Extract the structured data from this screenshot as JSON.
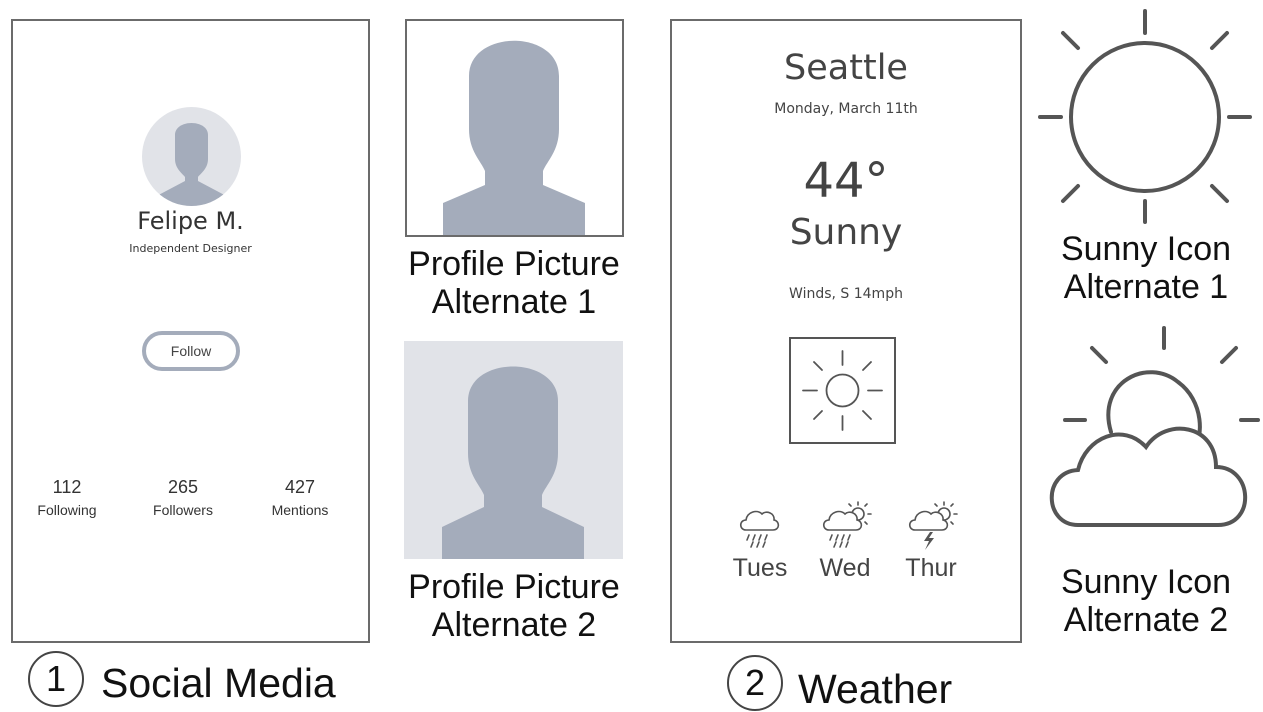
{
  "social": {
    "name": "Felipe M.",
    "role": "Independent Designer",
    "follow_label": "Follow",
    "stats": [
      {
        "value": "112",
        "label": "Following"
      },
      {
        "value": "265",
        "label": "Followers"
      },
      {
        "value": "427",
        "label": "Mentions"
      }
    ],
    "section_number": "1",
    "section_title": "Social Media"
  },
  "profile_alternates": {
    "alt1": [
      "Profile Picture",
      "Alternate 1"
    ],
    "alt2": [
      "Profile Picture",
      "Alternate 2"
    ]
  },
  "weather": {
    "city": "Seattle",
    "date": "Monday, March 11th",
    "temperature": "44°",
    "condition": "Sunny",
    "winds": "Winds, S 14mph",
    "forecast": [
      {
        "day": "Tues",
        "icon": "rain-cloud-icon"
      },
      {
        "day": "Wed",
        "icon": "sun-rain-cloud-icon"
      },
      {
        "day": "Thur",
        "icon": "sun-storm-cloud-icon"
      }
    ],
    "section_number": "2",
    "section_title": "Weather"
  },
  "sunny_alternates": {
    "alt1": [
      "Sunny Icon",
      "Alternate 1"
    ],
    "alt2": [
      "Sunny Icon",
      "Alternate 2"
    ]
  },
  "colors": {
    "frame": "#6b6b6b",
    "avatar_fill": "#a4acbb",
    "avatar_bg": "#e1e3e8",
    "icon_stroke": "#555555"
  }
}
